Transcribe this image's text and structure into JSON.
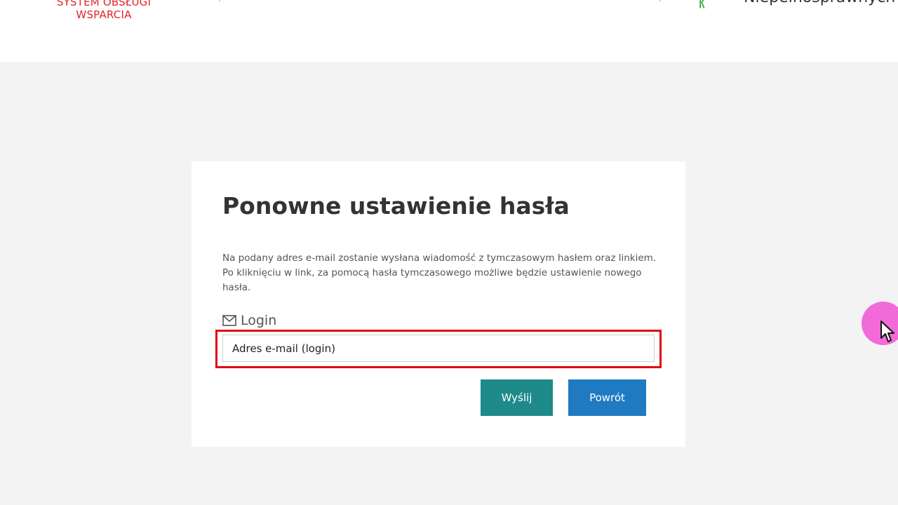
{
  "header": {
    "logo_line1": "SYSTEM OBSŁUGI",
    "logo_line2": "WSPARCIA",
    "partner_text": "Niepełnosprawnych",
    "partner_mark": "ᚱ"
  },
  "card": {
    "title": "Ponowne ustawienie hasła",
    "description": "Na podany adres e-mail zostanie wysłana wiadomość z tymczasowym hasłem oraz linkiem. Po kliknięciu w link, za pomocą hasła tymczasowego możliwe będzie ustawienie nowego hasła.",
    "login_label": "Login",
    "login_placeholder": "Adres e-mail (login)",
    "login_value": "",
    "send_button": "Wyślij",
    "back_button": "Powrót"
  },
  "colors": {
    "brand_red": "#e0262a",
    "highlight_red": "#e00712",
    "send_teal": "#1f8a8a",
    "back_blue": "#1f7ac2",
    "cursor_halo": "#f26ad7"
  },
  "icons": {
    "login": "envelope-icon",
    "pointer": "mouse-cursor-icon"
  }
}
